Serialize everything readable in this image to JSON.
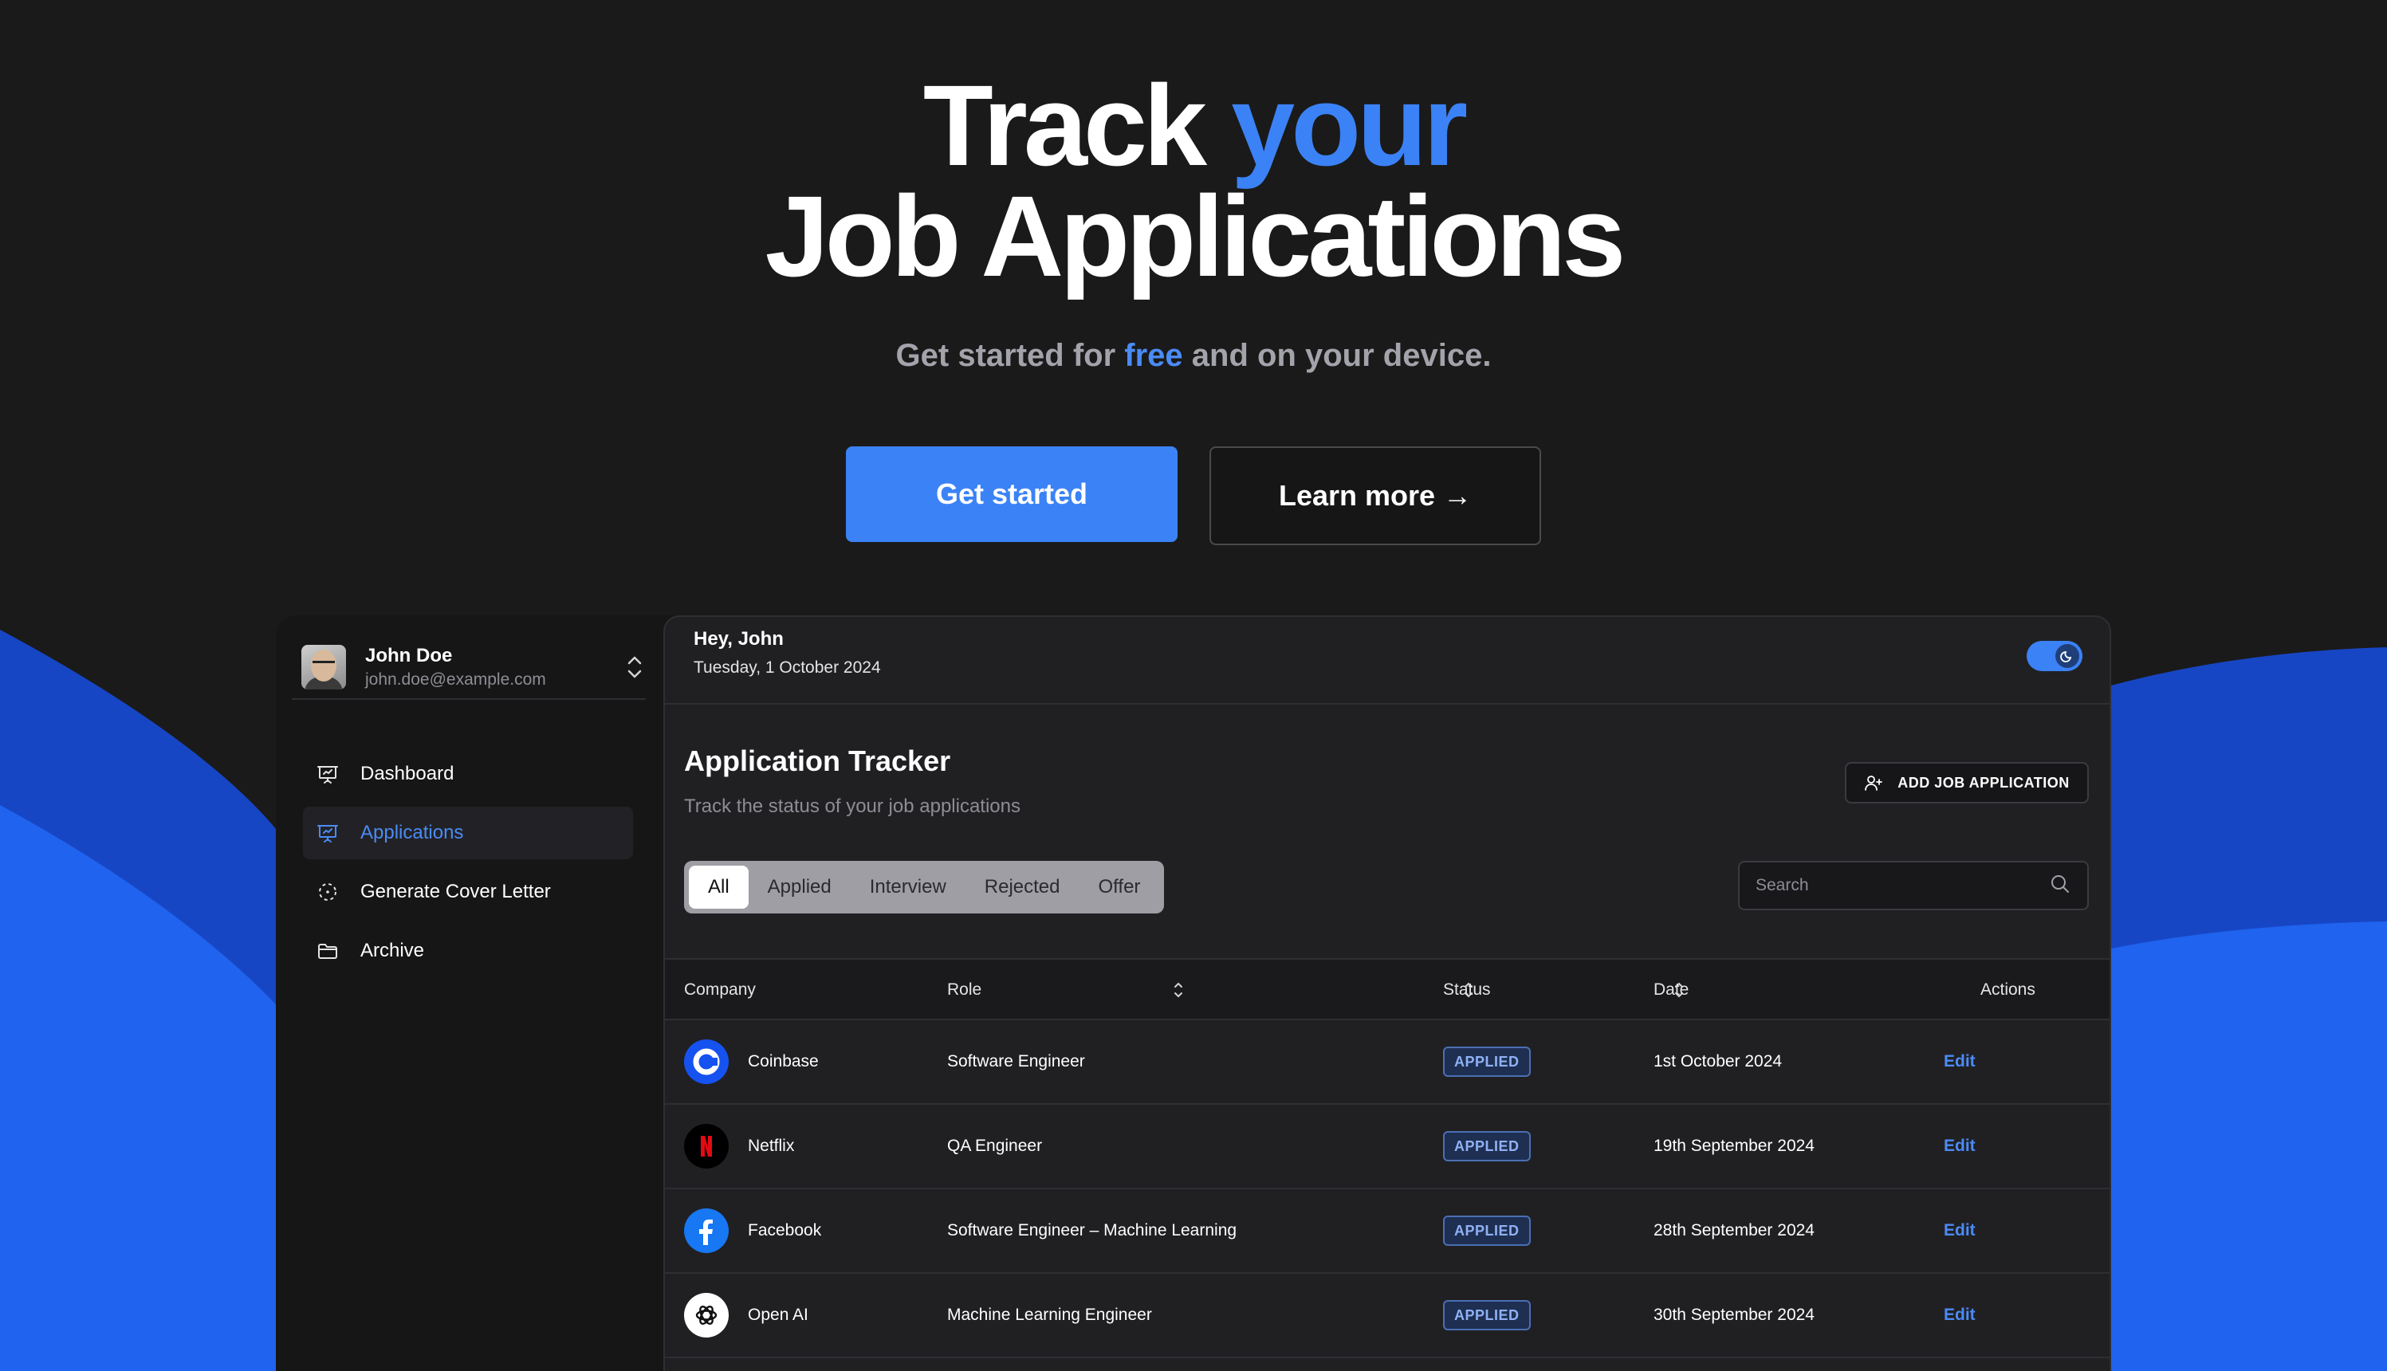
{
  "hero": {
    "title_word1": "Track",
    "title_word2": "your",
    "title_line2": "Job Applications",
    "subtitle_pre": "Get started for",
    "subtitle_free": "free",
    "subtitle_post": "and on your device.",
    "primary_button": "Get started",
    "secondary_button": "Learn more →"
  },
  "sidebar": {
    "user": {
      "name": "John Doe",
      "email": "john.doe@example.com"
    },
    "items": [
      {
        "label": "Dashboard",
        "icon": "presentation-chart-icon",
        "active": false
      },
      {
        "label": "Applications",
        "icon": "presentation-chart-icon",
        "active": true
      },
      {
        "label": "Generate Cover Letter",
        "icon": "dashed-circle-icon",
        "active": false
      },
      {
        "label": "Archive",
        "icon": "folder-icon",
        "active": false
      }
    ]
  },
  "header": {
    "greeting": "Hey, John",
    "date": "Tuesday, 1 October 2024"
  },
  "tracker": {
    "title": "Application Tracker",
    "subtitle": "Track the status of your job applications",
    "add_button": "ADD JOB APPLICATION",
    "tabs": [
      "All",
      "Applied",
      "Interview",
      "Rejected",
      "Offer"
    ],
    "active_tab": "All",
    "search_placeholder": "Search",
    "columns": {
      "company": "Company",
      "role": "Role",
      "status": "Status",
      "date": "Date",
      "actions": "Actions"
    },
    "rows": [
      {
        "company": "Coinbase",
        "role": "Software Engineer",
        "status": "APPLIED",
        "date": "1st October 2024",
        "action": "Edit",
        "logo": "coinbase-logo-icon"
      },
      {
        "company": "Netflix",
        "role": "QA Engineer",
        "status": "APPLIED",
        "date": "19th September 2024",
        "action": "Edit",
        "logo": "netflix-logo-icon"
      },
      {
        "company": "Facebook",
        "role": "Software Engineer – Machine Learning",
        "status": "APPLIED",
        "date": "28th September 2024",
        "action": "Edit",
        "logo": "facebook-logo-icon"
      },
      {
        "company": "Open AI",
        "role": "Machine Learning Engineer",
        "status": "APPLIED",
        "date": "30th September 2024",
        "action": "Edit",
        "logo": "openai-logo-icon"
      }
    ]
  },
  "colors": {
    "background": "#1a1a1a",
    "accent": "#3b82f6",
    "wave": "#1f5fe6",
    "panel": "#202023"
  }
}
